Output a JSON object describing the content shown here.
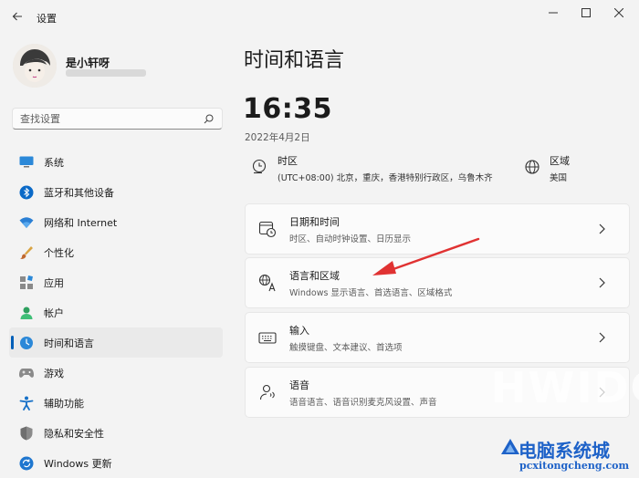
{
  "window": {
    "title": "设置",
    "back_icon": "back-arrow-icon",
    "controls": [
      "minimize-icon",
      "maximize-icon",
      "close-icon"
    ]
  },
  "user": {
    "name": "是小轩呀"
  },
  "search": {
    "placeholder": "查找设置"
  },
  "sidebar": {
    "items": [
      {
        "label": "系统",
        "icon": "system-icon",
        "active": false
      },
      {
        "label": "蓝牙和其他设备",
        "icon": "bluetooth-icon",
        "active": false
      },
      {
        "label": "网络和 Internet",
        "icon": "wifi-icon",
        "active": false
      },
      {
        "label": "个性化",
        "icon": "brush-icon",
        "active": false
      },
      {
        "label": "应用",
        "icon": "apps-icon",
        "active": false
      },
      {
        "label": "帐户",
        "icon": "account-icon",
        "active": false
      },
      {
        "label": "时间和语言",
        "icon": "time-language-icon",
        "active": true
      },
      {
        "label": "游戏",
        "icon": "gamepad-icon",
        "active": false
      },
      {
        "label": "辅助功能",
        "icon": "accessibility-icon",
        "active": false
      },
      {
        "label": "隐私和安全性",
        "icon": "shield-icon",
        "active": false
      },
      {
        "label": "Windows 更新",
        "icon": "update-icon",
        "active": false
      }
    ]
  },
  "main": {
    "title": "时间和语言",
    "time": "16:35",
    "date": "2022年4月2日",
    "timezone": {
      "label": "时区",
      "value": "(UTC+08:00) 北京，重庆，香港特别行政区，乌鲁木齐"
    },
    "region": {
      "label": "区域",
      "value": "美国"
    },
    "cards": [
      {
        "title": "日期和时间",
        "subtitle": "时区、自动时钟设置、日历显示",
        "icon": "calendar-clock-icon"
      },
      {
        "title": "语言和区域",
        "subtitle": "Windows 显示语言、首选语言、区域格式",
        "icon": "language-icon"
      },
      {
        "title": "输入",
        "subtitle": "触摸键盘、文本建议、首选项",
        "icon": "keyboard-icon"
      },
      {
        "title": "语音",
        "subtitle": "语音语言、语音识别麦克风设置、声音",
        "icon": "speech-icon"
      }
    ]
  },
  "colors": {
    "accent": "#005fb8",
    "background": "#f3f3f3",
    "card": "#fbfbfb",
    "annotation_arrow": "#e03232"
  },
  "watermark": {
    "primary": "HWIDC",
    "brand": "电脑系统城",
    "url": "pcxitongcheng.com"
  }
}
